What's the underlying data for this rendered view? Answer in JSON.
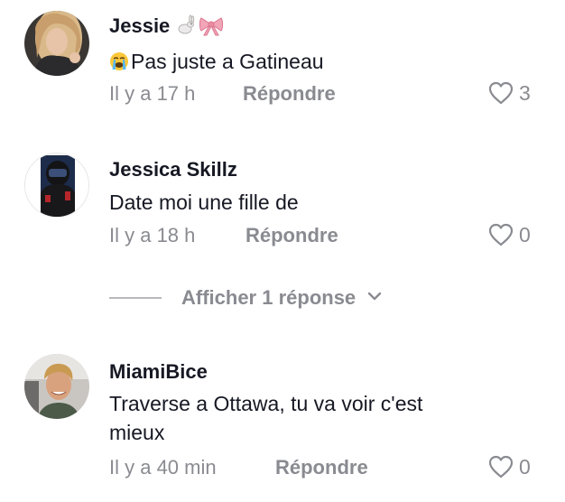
{
  "comments": [
    {
      "username": "Jessie",
      "name_emojis": [
        "rabbit-emoji",
        "ribbon-emoji"
      ],
      "text_prefix_emoji": "crying-face-emoji",
      "text": "Pas juste a Gatineau",
      "time": "Il y a 17 h",
      "reply_label": "Répondre",
      "likes": "3"
    },
    {
      "username": "Jessica Skillz",
      "text": "Date moi une fille de",
      "time": "Il y a 18 h",
      "reply_label": "Répondre",
      "likes": "0",
      "view_replies_label": "Afficher 1 réponse"
    },
    {
      "username": "MiamiBice",
      "text": "Traverse a Ottawa, tu va voir c'est\nmieux",
      "time": "Il y a 40 min",
      "reply_label": "Répondre",
      "likes": "0"
    }
  ],
  "colors": {
    "primary_text": "#161823",
    "secondary_text": "#8a8b91",
    "background": "#ffffff"
  },
  "icons": {
    "like": "heart-outline-icon",
    "expand": "chevron-down-icon"
  }
}
